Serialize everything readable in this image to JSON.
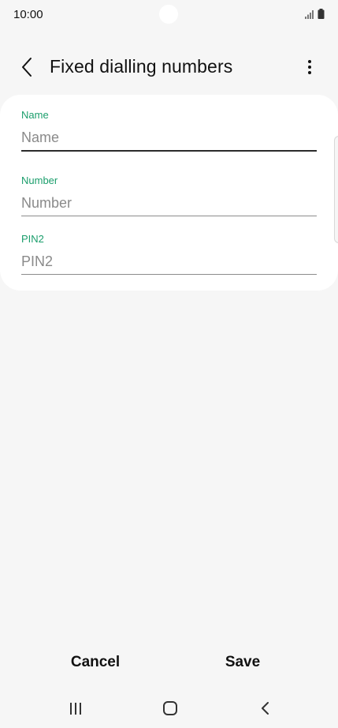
{
  "status_bar": {
    "time": "10:00",
    "icons": [
      "signal-icon",
      "battery-icon"
    ]
  },
  "header": {
    "title": "Fixed dialling numbers",
    "back_icon": "chevron-left-icon",
    "more_icon": "more-vertical-icon"
  },
  "form": {
    "fields": [
      {
        "label": "Name",
        "placeholder": "Name",
        "value": ""
      },
      {
        "label": "Number",
        "placeholder": "Number",
        "value": ""
      },
      {
        "label": "PIN2",
        "placeholder": "PIN2",
        "value": ""
      }
    ]
  },
  "actions": {
    "cancel_label": "Cancel",
    "save_label": "Save"
  },
  "nav_bar": {
    "icons": [
      "recents-icon",
      "home-icon",
      "back-icon"
    ]
  },
  "colors": {
    "accent": "#1b9e6c",
    "background": "#f6f6f6",
    "card": "#ffffff"
  }
}
